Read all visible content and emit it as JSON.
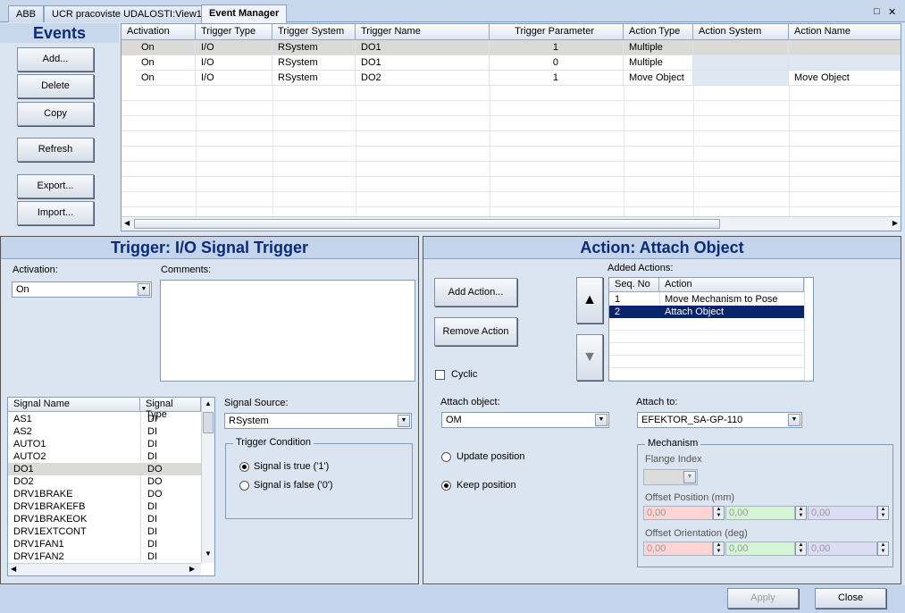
{
  "tabs": [
    "ABB",
    "UCR pracoviste UDALOSTI:View1",
    "Event Manager"
  ],
  "window_controls": {
    "restore": "□",
    "close": "✕"
  },
  "events": {
    "title": "Events",
    "buttons": {
      "add": "Add...",
      "delete": "Delete",
      "copy": "Copy",
      "refresh": "Refresh",
      "export": "Export...",
      "import": "Import..."
    },
    "grid": {
      "columns": [
        "Activation",
        "Trigger Type",
        "Trigger System",
        "Trigger Name",
        "Trigger Parameter",
        "Action Type",
        "Action System",
        "Action Name"
      ],
      "rows": [
        [
          "On",
          "I/O",
          "RSystem",
          "DO1",
          "1",
          "Multiple",
          "",
          ""
        ],
        [
          "On",
          "I/O",
          "RSystem",
          "DO1",
          "0",
          "Multiple",
          "",
          ""
        ],
        [
          "On",
          "I/O",
          "RSystem",
          "DO2",
          "1",
          "Move Object",
          "",
          "Move Object"
        ]
      ]
    }
  },
  "trigger": {
    "title": "Trigger: I/O Signal Trigger",
    "activation_label": "Activation:",
    "activation_value": "On",
    "comments_label": "Comments:",
    "signal_list": {
      "headers": [
        "Signal Name",
        "Signal Type"
      ],
      "rows": [
        [
          "AS1",
          "DI"
        ],
        [
          "AS2",
          "DI"
        ],
        [
          "AUTO1",
          "DI"
        ],
        [
          "AUTO2",
          "DI"
        ],
        [
          "DO1",
          "DO"
        ],
        [
          "DO2",
          "DO"
        ],
        [
          "DRV1BRAKE",
          "DO"
        ],
        [
          "DRV1BRAKEFB",
          "DI"
        ],
        [
          "DRV1BRAKEOK",
          "DI"
        ],
        [
          "DRV1EXTCONT",
          "DI"
        ],
        [
          "DRV1FAN1",
          "DI"
        ],
        [
          "DRV1FAN2",
          "DI"
        ]
      ]
    },
    "signal_source_label": "Signal Source:",
    "signal_source_value": "RSystem",
    "condition_group": "Trigger Condition",
    "condition_true": "Signal is true ('1')",
    "condition_false": "Signal is false ('0')"
  },
  "action": {
    "title": "Action: Attach Object",
    "add_action": "Add Action...",
    "remove_action": "Remove Action",
    "added_actions_label": "Added Actions:",
    "added_actions": {
      "headers": [
        "Seq. No",
        "Action"
      ],
      "rows": [
        [
          "1",
          "Move Mechanism to Pose"
        ],
        [
          "2",
          "Attach Object"
        ]
      ]
    },
    "cyclic_label": "Cyclic",
    "attach_object_label": "Attach object:",
    "attach_object_value": "OM",
    "attach_to_label": "Attach to:",
    "attach_to_value": "EFEKTOR_SA-GP-110",
    "update_position": "Update position",
    "keep_position": "Keep position",
    "mechanism_group": "Mechanism",
    "flange_index_label": "Flange Index",
    "offset_position_label": "Offset Position (mm)",
    "offset_orientation_label": "Offset Orientation (deg)",
    "offset_position": [
      "0,00",
      "0,00",
      "0,00"
    ],
    "offset_orientation": [
      "0,00",
      "0,00",
      "0,00"
    ]
  },
  "footer": {
    "apply": "Apply",
    "close": "Close"
  }
}
